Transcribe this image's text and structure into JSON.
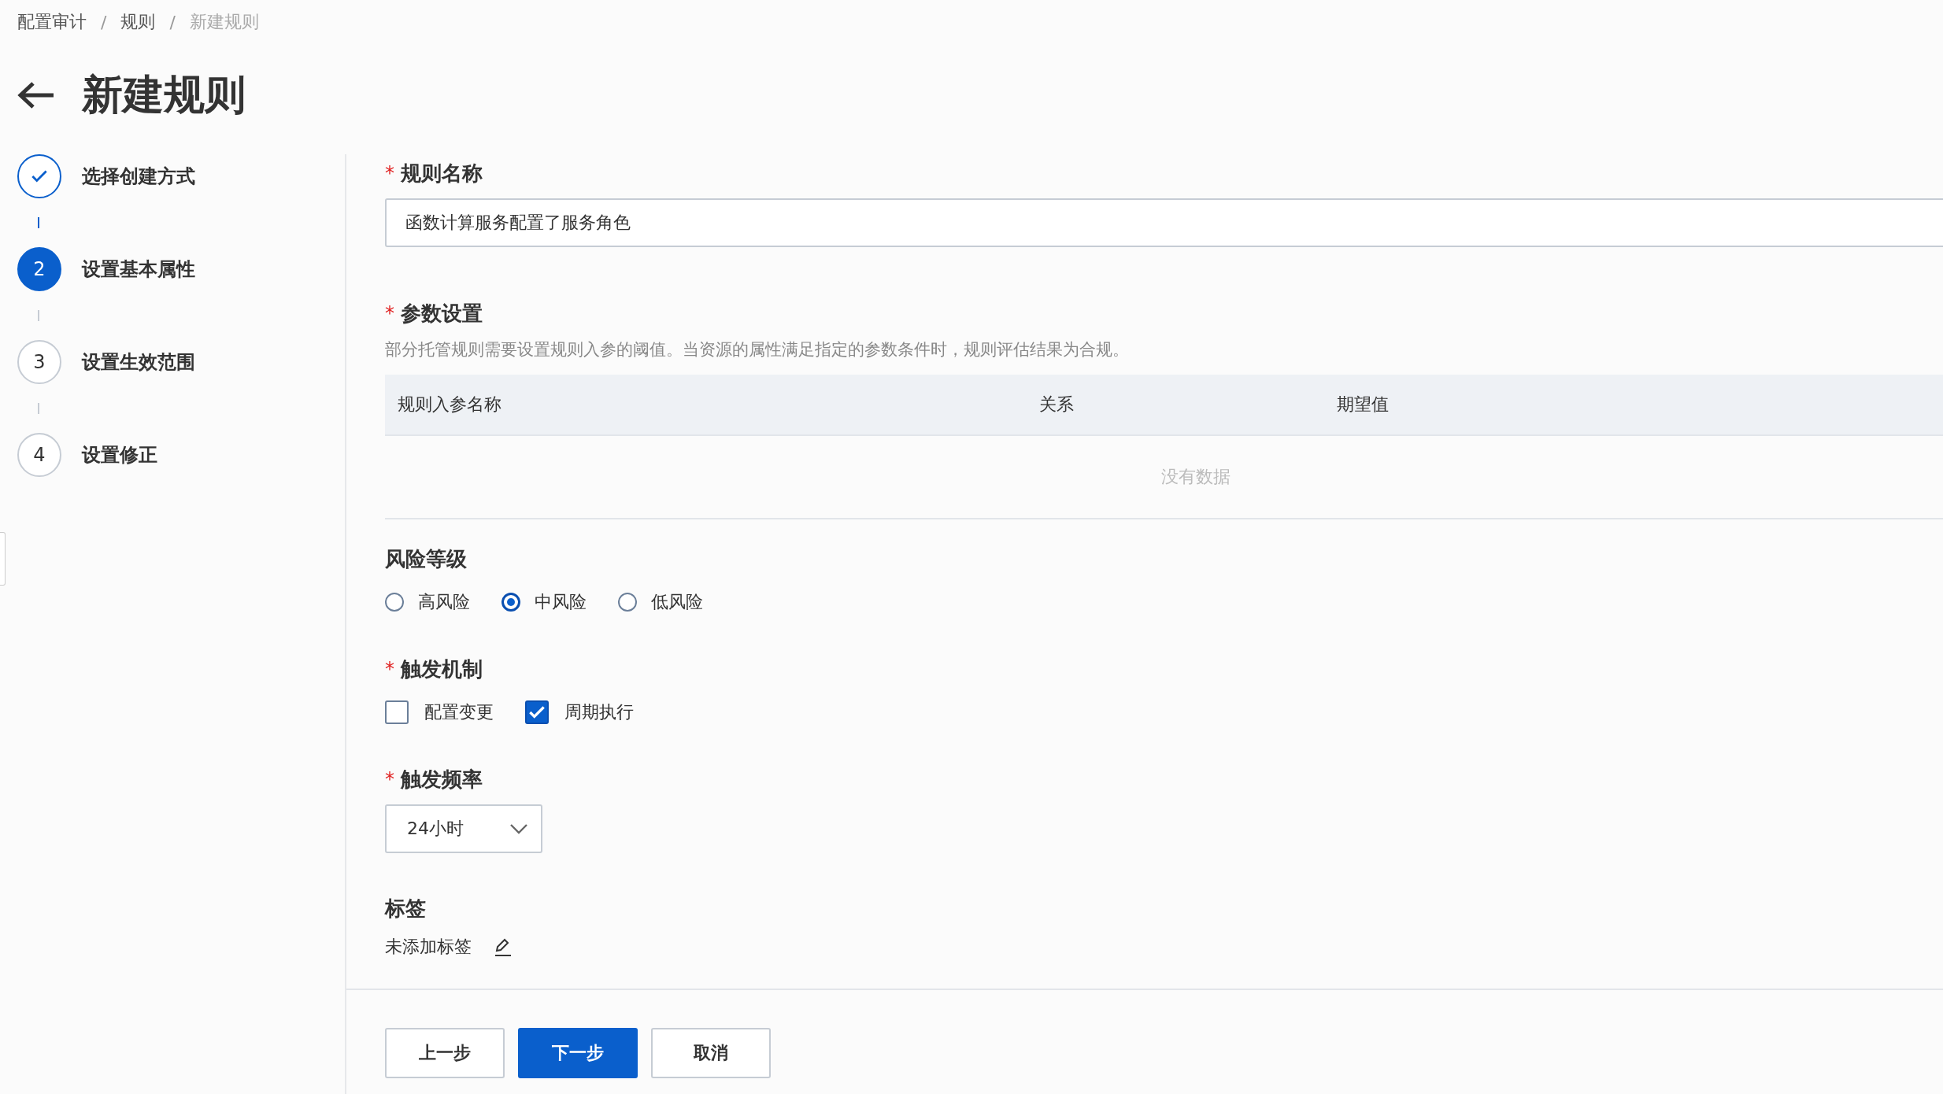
{
  "breadcrumb": [
    {
      "label": "配置审计",
      "current": false
    },
    {
      "separator": "/",
      "label": "规则",
      "current": false
    },
    {
      "separator": "/",
      "label": "新建规则",
      "current": true
    }
  ],
  "title": "新建规则",
  "steps": [
    {
      "label": "选择创建方式",
      "completed": true,
      "selected": false
    },
    {
      "number": "2",
      "label": "设置基本属性",
      "completed": false,
      "selected": true
    },
    {
      "number": "3",
      "label": "设置生效范围",
      "completed": false,
      "selected": false
    },
    {
      "number": "4",
      "label": "设置修正",
      "completed": false,
      "selected": false
    }
  ],
  "rule_name": {
    "required_mark": "*",
    "label": "规则名称",
    "value": "函数计算服务配置了服务角色"
  },
  "parameters": {
    "required_mark": "*",
    "label": "参数设置",
    "description": "部分托管规则需要设置规则入参的阈值。当资源的属性满足指定的参数条件时，规则评估结果为合规。",
    "columns": [
      "规则入参名称",
      "关系",
      "期望值"
    ],
    "empty_text": "没有数据"
  },
  "risk_level": {
    "label": "风险等级",
    "options": [
      {
        "label": "高风险",
        "selected": false
      },
      {
        "label": "中风险",
        "selected": true
      },
      {
        "label": "低风险",
        "selected": false
      }
    ]
  },
  "trigger": {
    "required_mark": "*",
    "label": "触发机制",
    "options": [
      {
        "label": "配置变更",
        "checked": false
      },
      {
        "label": "周期执行",
        "checked": true
      }
    ]
  },
  "frequency": {
    "required_mark": "*",
    "label": "触发频率",
    "value": "24小时"
  },
  "tags": {
    "label": "标签",
    "value": "未添加标签"
  },
  "buttons": [
    {
      "label": "上一步",
      "kind": "secondary"
    },
    {
      "label": "下一步",
      "kind": "primary"
    },
    {
      "label": "取消",
      "kind": "secondary"
    }
  ]
}
